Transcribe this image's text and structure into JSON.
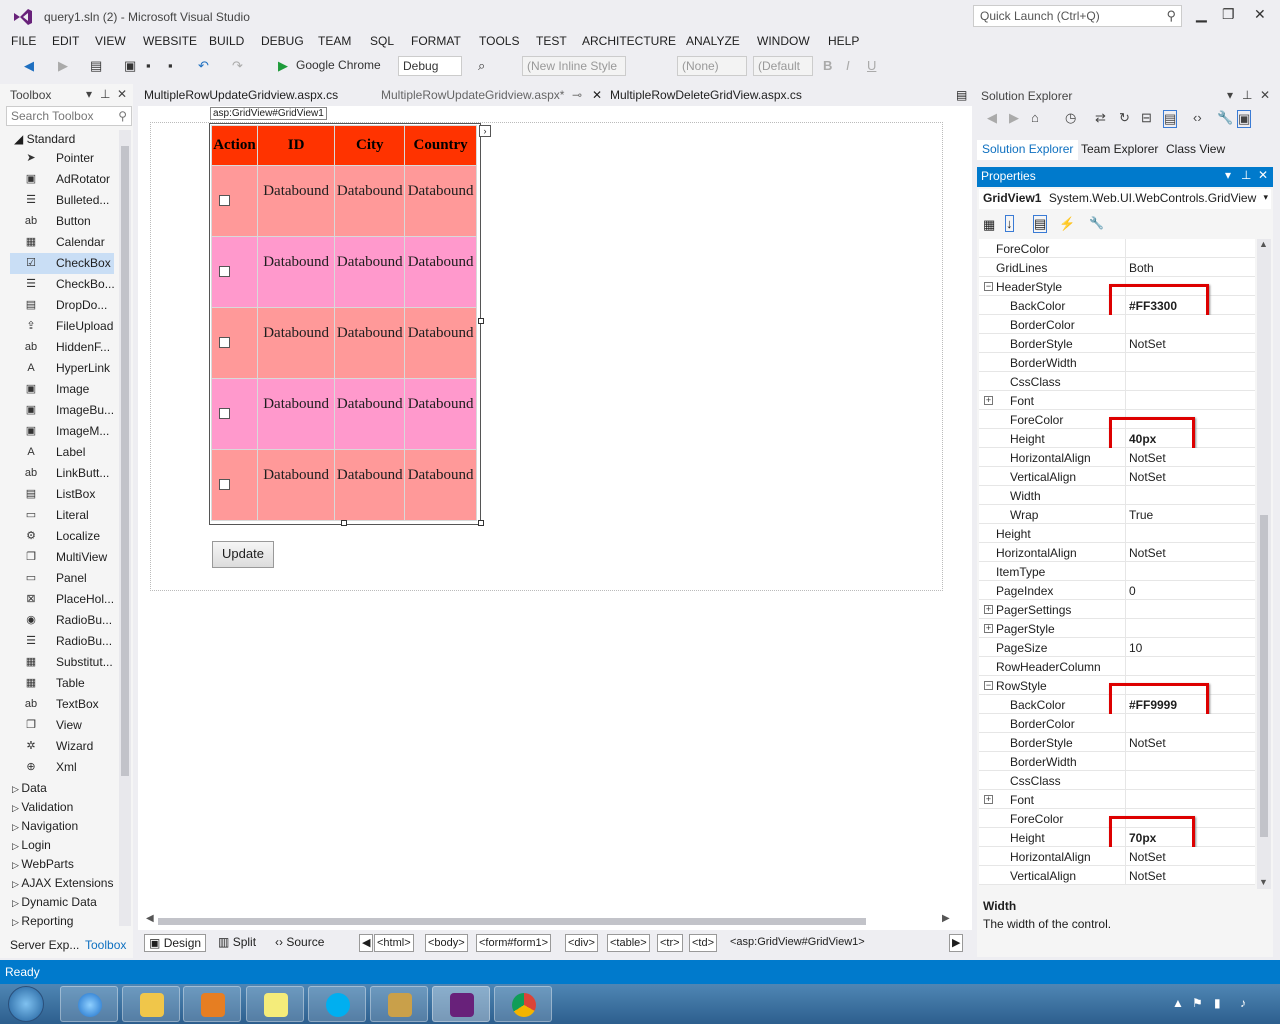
{
  "titlebar": {
    "title": "query1.sln (2) - Microsoft Visual Studio",
    "quick_launch": "Quick Launch (Ctrl+Q)"
  },
  "menu": [
    "FILE",
    "EDIT",
    "VIEW",
    "WEBSITE",
    "BUILD",
    "DEBUG",
    "TEAM",
    "SQL",
    "FORMAT",
    "TOOLS",
    "TEST",
    "ARCHITECTURE",
    "ANALYZE",
    "WINDOW",
    "HELP"
  ],
  "toolbar": {
    "run_target": "Google Chrome",
    "config": "Debug",
    "style": "(New Inline Style",
    "target_rule": "(None)",
    "font": "(Default",
    "bold": "B",
    "italic": "I",
    "underline": "U"
  },
  "toolbox": {
    "title": "Toolbox",
    "search_placeholder": "Search Toolbox",
    "group": "Standard",
    "items": [
      {
        "label": "Pointer",
        "icon": "pointer-icon",
        "glyph": "➤"
      },
      {
        "label": "AdRotator",
        "icon": "adrotator-icon",
        "glyph": "▣"
      },
      {
        "label": "Bulleted...",
        "icon": "bulleted-list-icon",
        "glyph": "☰"
      },
      {
        "label": "Button",
        "icon": "button-icon",
        "glyph": "ab"
      },
      {
        "label": "Calendar",
        "icon": "calendar-icon",
        "glyph": "▦"
      },
      {
        "label": "CheckBox",
        "icon": "checkbox-icon",
        "glyph": "☑"
      },
      {
        "label": "CheckBo...",
        "icon": "checkbox-list-icon",
        "glyph": "☰"
      },
      {
        "label": "DropDo...",
        "icon": "dropdown-icon",
        "glyph": "▤"
      },
      {
        "label": "FileUpload",
        "icon": "fileupload-icon",
        "glyph": "⇪"
      },
      {
        "label": "HiddenF...",
        "icon": "hiddenfield-icon",
        "glyph": "ab"
      },
      {
        "label": "HyperLink",
        "icon": "hyperlink-icon",
        "glyph": "A"
      },
      {
        "label": "Image",
        "icon": "image-icon",
        "glyph": "▣"
      },
      {
        "label": "ImageBu...",
        "icon": "imagebutton-icon",
        "glyph": "▣"
      },
      {
        "label": "ImageM...",
        "icon": "imagemap-icon",
        "glyph": "▣"
      },
      {
        "label": "Label",
        "icon": "label-icon",
        "glyph": "A"
      },
      {
        "label": "LinkButt...",
        "icon": "linkbutton-icon",
        "glyph": "ab"
      },
      {
        "label": "ListBox",
        "icon": "listbox-icon",
        "glyph": "▤"
      },
      {
        "label": "Literal",
        "icon": "literal-icon",
        "glyph": "▭"
      },
      {
        "label": "Localize",
        "icon": "localize-icon",
        "glyph": "⚙"
      },
      {
        "label": "MultiView",
        "icon": "multiview-icon",
        "glyph": "❐"
      },
      {
        "label": "Panel",
        "icon": "panel-icon",
        "glyph": "▭"
      },
      {
        "label": "PlaceHol...",
        "icon": "placeholder-icon",
        "glyph": "⊠"
      },
      {
        "label": "RadioBu...",
        "icon": "radiobutton-icon",
        "glyph": "◉"
      },
      {
        "label": "RadioBu...",
        "icon": "radiobuttonlist-icon",
        "glyph": "☰"
      },
      {
        "label": "Substitut...",
        "icon": "substitution-icon",
        "glyph": "▦"
      },
      {
        "label": "Table",
        "icon": "table-icon",
        "glyph": "▦"
      },
      {
        "label": "TextBox",
        "icon": "textbox-icon",
        "glyph": "ab"
      },
      {
        "label": "View",
        "icon": "view-icon",
        "glyph": "❐"
      },
      {
        "label": "Wizard",
        "icon": "wizard-icon",
        "glyph": "✲"
      },
      {
        "label": "Xml",
        "icon": "xml-icon",
        "glyph": "⊕"
      }
    ],
    "selected_item": "CheckBox",
    "categories": [
      "Data",
      "Validation",
      "Navigation",
      "Login",
      "WebParts",
      "AJAX Extensions",
      "Dynamic Data",
      "Reporting"
    ],
    "bottom_tabs": [
      "Server Exp...",
      "Toolbox"
    ]
  },
  "tabs": [
    {
      "label": "MultipleRowUpdateGridview.aspx.cs",
      "active": false
    },
    {
      "label": "MultipleRowUpdateGridview.aspx*",
      "active": true
    },
    {
      "label": "MultipleRowDeleteGridView.aspx.cs",
      "active": false
    }
  ],
  "designer": {
    "gridview_label": "asp:GridView#GridView1",
    "columns": [
      "Action",
      "ID",
      "City",
      "Country"
    ],
    "rows": [
      [
        "Databound",
        "Databound",
        "Databound"
      ],
      [
        "Databound",
        "Databound",
        "Databound"
      ],
      [
        "Databound",
        "Databound",
        "Databound"
      ],
      [
        "Databound",
        "Databound",
        "Databound"
      ],
      [
        "Databound",
        "Databound",
        "Databound"
      ]
    ],
    "header_color": "#FF3300",
    "row_color": "#FF9999",
    "alt_row_color": "#FF99CC",
    "update_button": "Update"
  },
  "bottombar": {
    "views": [
      "Design",
      "Split",
      "Source"
    ],
    "breadcrumbs": [
      "<html>",
      "<body>",
      "<form#form1>",
      "<div>",
      "<table>",
      "<tr>",
      "<td>"
    ],
    "current": "<asp:GridView#GridView1>"
  },
  "solution_explorer": {
    "title": "Solution Explorer",
    "tabs": [
      "Solution Explorer",
      "Team Explorer",
      "Class View"
    ]
  },
  "properties": {
    "title": "Properties",
    "object_name": "GridView1",
    "object_type": "System.Web.UI.WebControls.GridView",
    "rows": [
      {
        "name": "ForeColor",
        "value": "",
        "indent": 0
      },
      {
        "name": "GridLines",
        "value": "Both",
        "indent": 0
      },
      {
        "name": "HeaderStyle",
        "value": "",
        "indent": 0,
        "expander": "−"
      },
      {
        "name": "BackColor",
        "value": "#FF3300",
        "indent": 1,
        "bold": true
      },
      {
        "name": "BorderColor",
        "value": "",
        "indent": 1
      },
      {
        "name": "BorderStyle",
        "value": "NotSet",
        "indent": 1
      },
      {
        "name": "BorderWidth",
        "value": "",
        "indent": 1
      },
      {
        "name": "CssClass",
        "value": "",
        "indent": 1
      },
      {
        "name": "Font",
        "value": "",
        "indent": 1,
        "expander": "+"
      },
      {
        "name": "ForeColor",
        "value": "",
        "indent": 1
      },
      {
        "name": "Height",
        "value": "40px",
        "indent": 1,
        "bold": true
      },
      {
        "name": "HorizontalAlign",
        "value": "NotSet",
        "indent": 1
      },
      {
        "name": "VerticalAlign",
        "value": "NotSet",
        "indent": 1
      },
      {
        "name": "Width",
        "value": "",
        "indent": 1
      },
      {
        "name": "Wrap",
        "value": "True",
        "indent": 1
      },
      {
        "name": "Height",
        "value": "",
        "indent": 0
      },
      {
        "name": "HorizontalAlign",
        "value": "NotSet",
        "indent": 0
      },
      {
        "name": "ItemType",
        "value": "",
        "indent": 0
      },
      {
        "name": "PageIndex",
        "value": "0",
        "indent": 0
      },
      {
        "name": "PagerSettings",
        "value": "",
        "indent": 0,
        "expander": "+"
      },
      {
        "name": "PagerStyle",
        "value": "",
        "indent": 0,
        "expander": "+"
      },
      {
        "name": "PageSize",
        "value": "10",
        "indent": 0
      },
      {
        "name": "RowHeaderColumn",
        "value": "",
        "indent": 0
      },
      {
        "name": "RowStyle",
        "value": "",
        "indent": 0,
        "expander": "−"
      },
      {
        "name": "BackColor",
        "value": "#FF9999",
        "indent": 1,
        "bold": true
      },
      {
        "name": "BorderColor",
        "value": "",
        "indent": 1
      },
      {
        "name": "BorderStyle",
        "value": "NotSet",
        "indent": 1
      },
      {
        "name": "BorderWidth",
        "value": "",
        "indent": 1
      },
      {
        "name": "CssClass",
        "value": "",
        "indent": 1
      },
      {
        "name": "Font",
        "value": "",
        "indent": 1,
        "expander": "+"
      },
      {
        "name": "ForeColor",
        "value": "",
        "indent": 1
      },
      {
        "name": "Height",
        "value": "70px",
        "indent": 1,
        "bold": true
      },
      {
        "name": "HorizontalAlign",
        "value": "NotSet",
        "indent": 1
      },
      {
        "name": "VerticalAlign",
        "value": "NotSet",
        "indent": 1
      }
    ],
    "highlighted": [
      "#FF3300",
      "40px",
      "#FF9999",
      "70px"
    ],
    "description_title": "Width",
    "description_text": "The width of the control."
  },
  "status": "Ready",
  "accent": "#007ACC"
}
